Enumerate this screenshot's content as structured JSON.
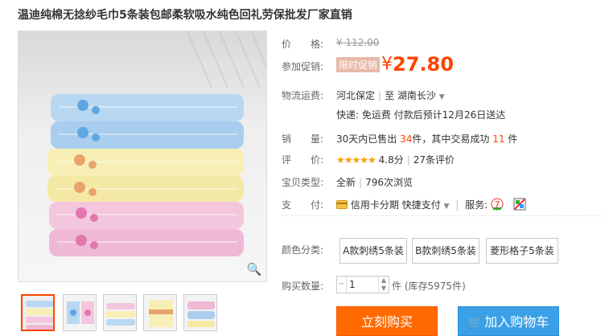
{
  "product": {
    "title": "温迪纯棉无捻纱毛巾5条装包邮柔软吸水纯色回礼劳保批发厂家直销"
  },
  "price": {
    "label": "价　　格:",
    "original": "¥ 112.00"
  },
  "promo": {
    "label": "参加促销:",
    "badge": "限时促销",
    "currency": "¥",
    "price": "27.80",
    "accent_color": "#ff4400"
  },
  "shipping": {
    "label": "物流运费:",
    "from": "河北保定",
    "sep": "|",
    "to_prefix": "至",
    "to": "湖南长沙",
    "delivery": "快递: 免运费 付款后预计12月26日送达"
  },
  "sales": {
    "label": "销　　量:",
    "prefix": "30天内已售出",
    "count": "34",
    "middle": "件，其中交易成功",
    "success": "11",
    "suffix": "件"
  },
  "rating": {
    "label": "评　　价:",
    "stars": "★★★★★",
    "score": "4.8分",
    "sep": "|",
    "reviews": "27条评价"
  },
  "type": {
    "label": "宝贝类型:",
    "value": "全新",
    "sep": "|",
    "views": "796次浏览"
  },
  "payment": {
    "label": "支　　付:",
    "credit": "信用卡分期",
    "quick": "快捷支付",
    "sep": "|",
    "service": "服务:"
  },
  "color": {
    "label": "颜色分类:",
    "options": [
      "A款刺绣5条装",
      "B款刺绣5条装",
      "菱形格子5条装"
    ]
  },
  "quantity": {
    "label": "购买数量:",
    "value": "1",
    "unit": "件",
    "stock": "(库存5975件)"
  },
  "actions": {
    "buy": "立刻购买",
    "cart": "加入购物车"
  },
  "icons": {
    "zoom": "magnifier-icon",
    "credit": "credit-card-icon",
    "service7": "seven-day-return-icon",
    "service2": "guarantee-icon",
    "cart": "shopping-cart-icon"
  }
}
